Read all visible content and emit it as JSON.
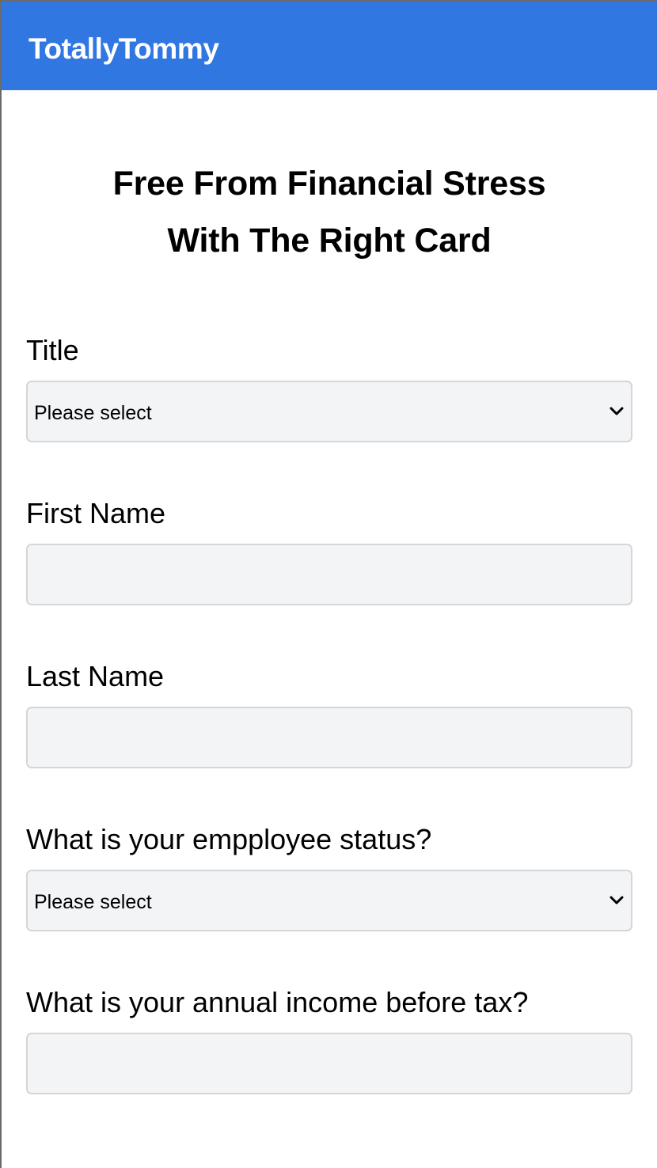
{
  "header": {
    "brand": "TotallyTommy",
    "color": "#3177e1"
  },
  "hero": {
    "line1": "Free From Financial Stress",
    "line2": "With The Right Card"
  },
  "form": {
    "title_field": {
      "label": "Title",
      "value": "Please select"
    },
    "first_name": {
      "label": "First Name",
      "value": ""
    },
    "last_name": {
      "label": "Last Name",
      "value": ""
    },
    "employee_status": {
      "label": "What is your empployee status?",
      "value": "Please select"
    },
    "annual_income": {
      "label": "What is your annual income before tax?",
      "value": ""
    }
  },
  "icons": {
    "select_arrow": "chevron-down-icon"
  }
}
